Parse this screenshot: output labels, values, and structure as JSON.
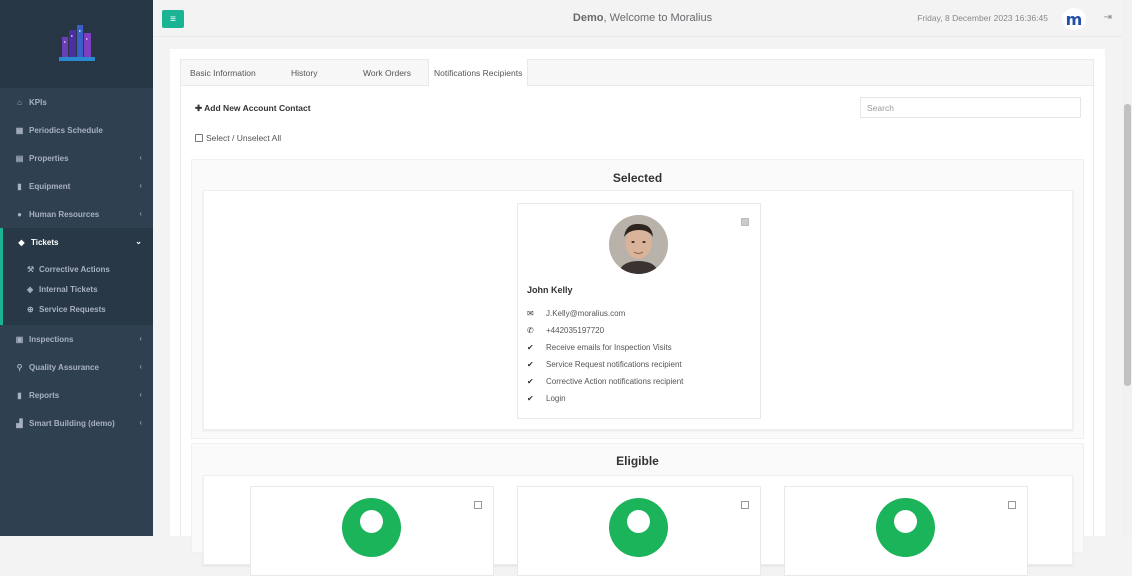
{
  "sidebar": {
    "items": [
      {
        "label": "KPIs",
        "icon": "home-icon"
      },
      {
        "label": "Periodics Schedule",
        "icon": "calendar-icon"
      },
      {
        "label": "Properties",
        "icon": "building-icon"
      },
      {
        "label": "Equipment",
        "icon": "book-icon"
      },
      {
        "label": "Human Resources",
        "icon": "users-icon"
      },
      {
        "label": "Tickets",
        "icon": "tag-icon"
      },
      {
        "label": "Inspections",
        "icon": "clipboard-icon"
      },
      {
        "label": "Quality Assurance",
        "icon": "search-icon"
      },
      {
        "label": "Reports",
        "icon": "book-icon"
      },
      {
        "label": "Smart Building (demo)",
        "icon": "chart-icon"
      }
    ],
    "tickets_sub": [
      {
        "label": "Corrective Actions",
        "icon": "wrench-icon"
      },
      {
        "label": "Internal Tickets",
        "icon": "tags-icon"
      },
      {
        "label": "Service Requests",
        "icon": "lifebuoy-icon"
      }
    ]
  },
  "header": {
    "company": "Demo",
    "welcome": ", Welcome to Moralius",
    "datetime": "Friday, 8 December 2023 16:36:45",
    "brand_letter": "m"
  },
  "tabs": [
    {
      "label": "Basic Information"
    },
    {
      "label": "History"
    },
    {
      "label": "Work Orders"
    },
    {
      "label": "Notifications Recipients"
    }
  ],
  "panel": {
    "add_contact": "Add New Account Contact",
    "search_placeholder": "Search",
    "select_all": "Select / Unselect All",
    "selected_title": "Selected",
    "eligible_title": "Eligible"
  },
  "selected_contact": {
    "name": "John Kelly",
    "email": "J.Kelly@moralius.com",
    "phone": "+442035197720",
    "features": [
      "Receive emails for Inspection Visits",
      "Service Request notifications recipient",
      "Corrective Action notifications recipient",
      "Login"
    ]
  },
  "colors": {
    "accent": "#1ab394",
    "sidebar": "#2f4050",
    "avatar_green": "#1cb45a"
  }
}
